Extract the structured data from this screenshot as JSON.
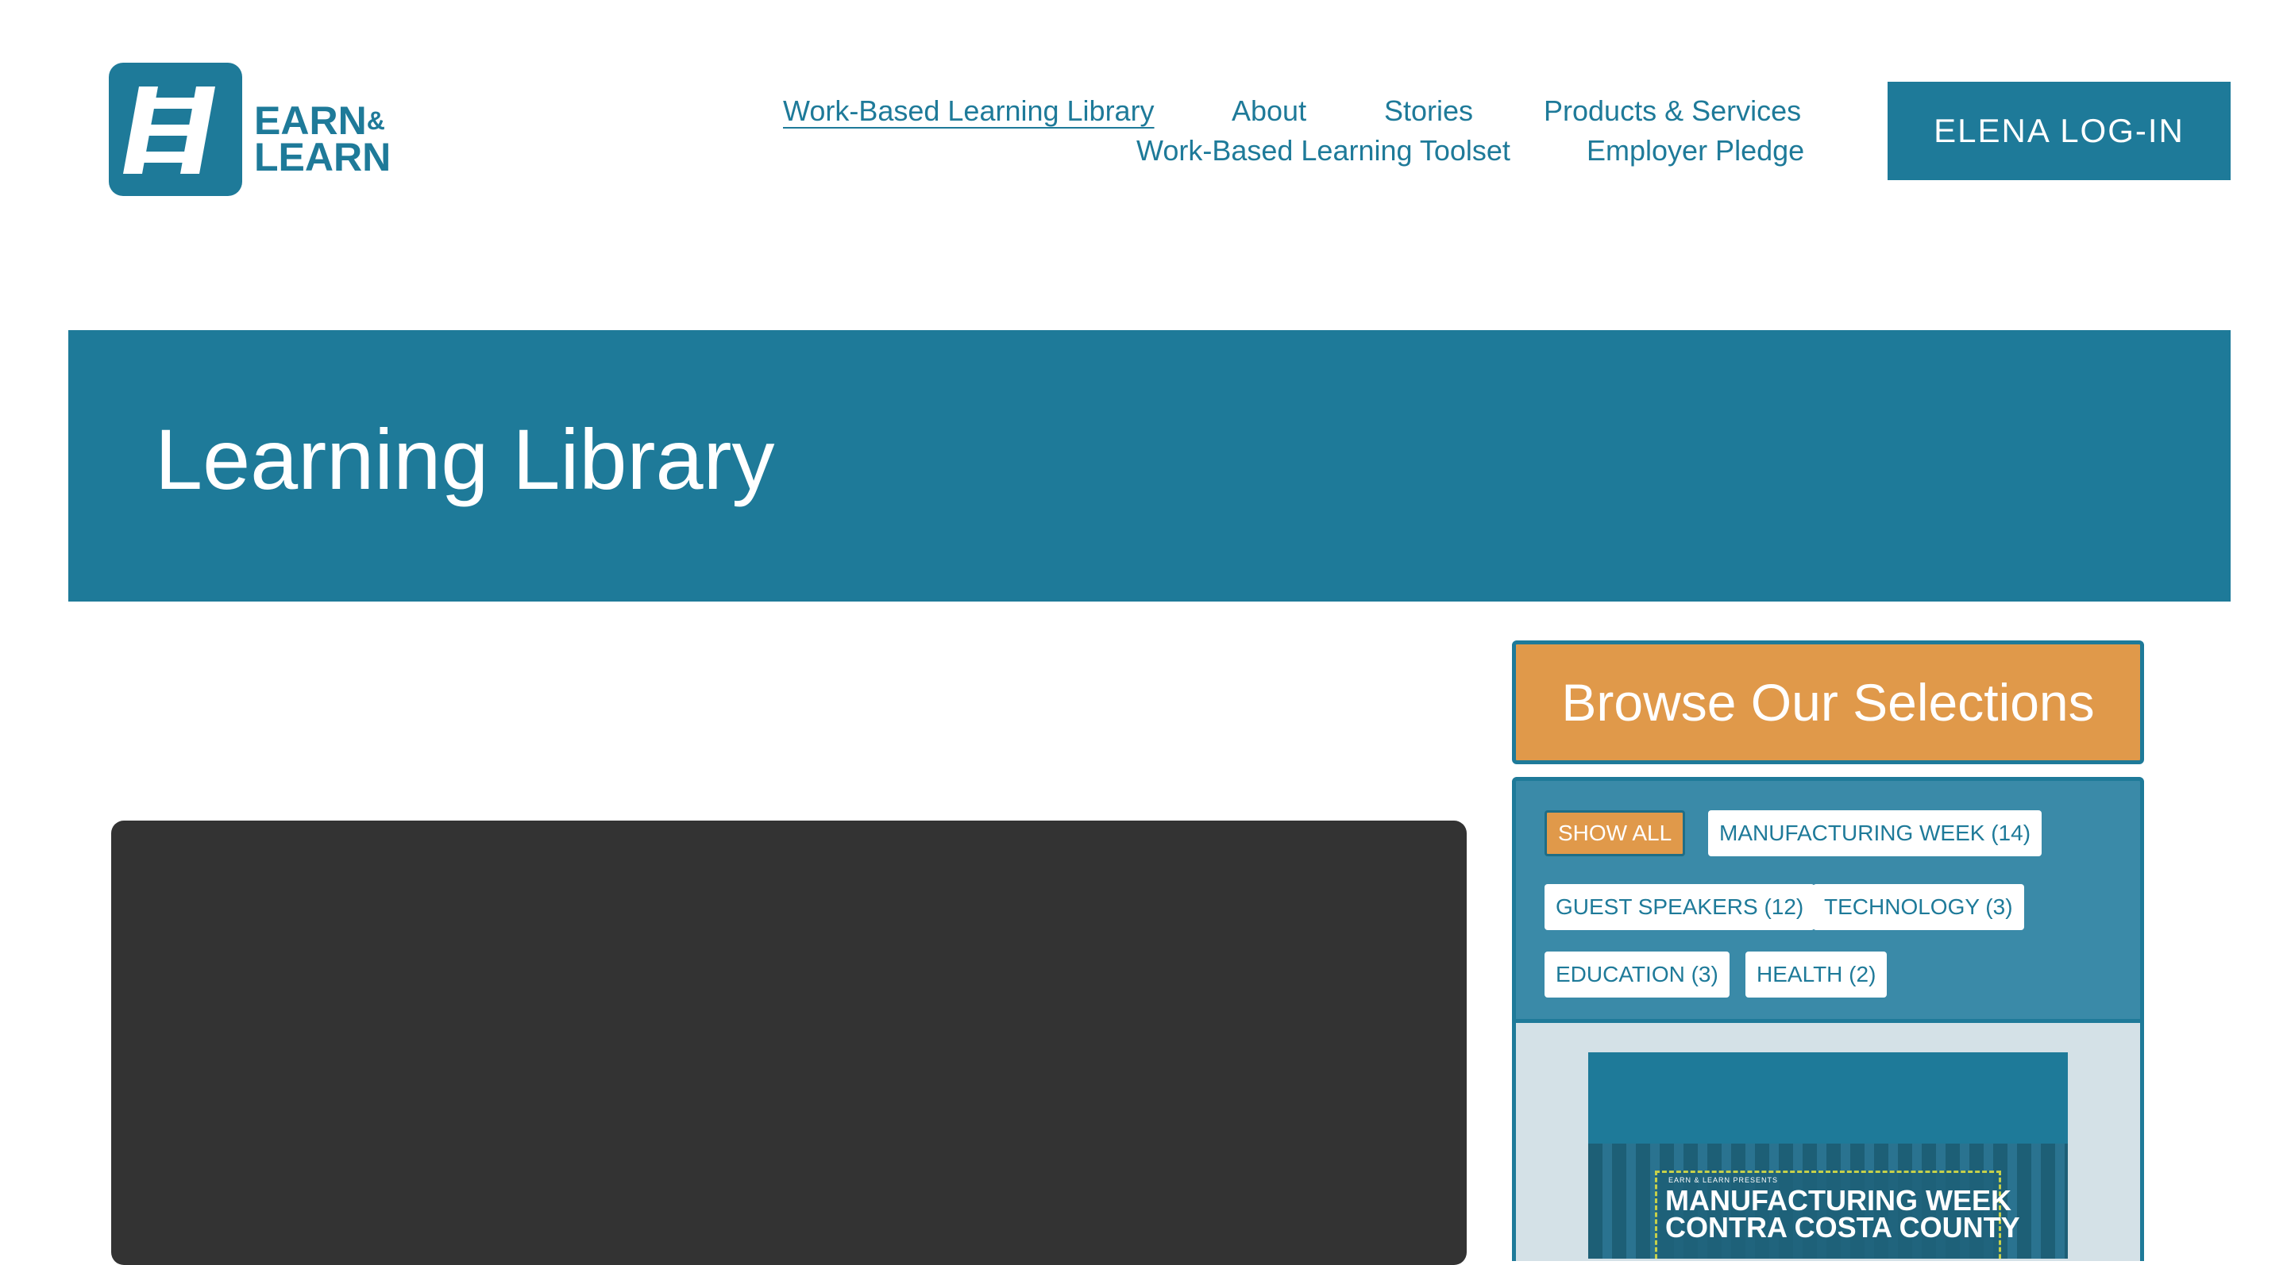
{
  "logo": {
    "line1": "EARN",
    "amp": "&",
    "line2": "LEARN",
    "icon": "ladder-logo-icon"
  },
  "nav": {
    "items": [
      {
        "label": "Work-Based Learning Library",
        "active": true
      },
      {
        "label": "About"
      },
      {
        "label": "Stories"
      },
      {
        "label": "Products & Services"
      },
      {
        "label": "Work-Based Learning Toolset"
      },
      {
        "label": "Employer Pledge"
      }
    ],
    "login_label": "ELENA LOG-IN"
  },
  "hero": {
    "title": "Learning Library"
  },
  "sidebar": {
    "heading": "Browse Our Selections",
    "filters": [
      {
        "label": "SHOW ALL",
        "active": true
      },
      {
        "label": "MANUFACTURING WEEK (14)"
      },
      {
        "label": "GUEST SPEAKERS (12)"
      },
      {
        "label": "TECHNOLOGY (3)"
      },
      {
        "label": "EDUCATION (3)"
      },
      {
        "label": "HEALTH (2)"
      }
    ],
    "thumbnail": {
      "small_text": "EARN & LEARN PRESENTS",
      "title_line1": "MANUFACTURING WEEK",
      "title_line2": "CONTRA COSTA COUNTY"
    }
  },
  "colors": {
    "brand": "#1e7a99",
    "accent": "#e0994a",
    "video_bg": "#333333",
    "panel_bg": "#3a8aa8"
  }
}
